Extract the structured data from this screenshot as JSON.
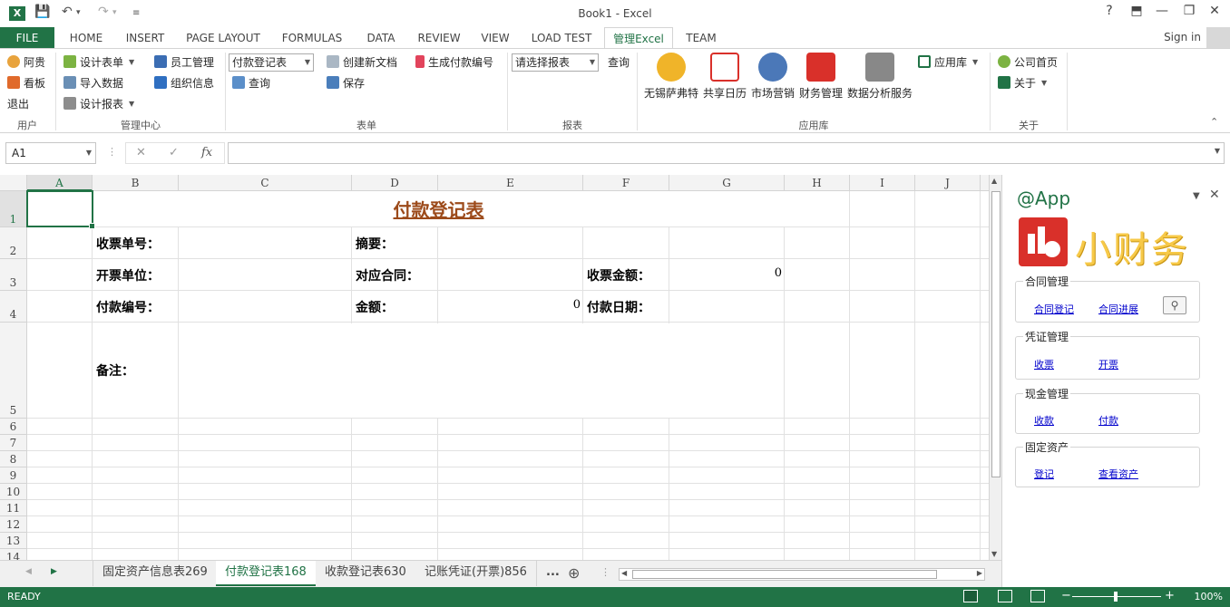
{
  "titlebar": {
    "title": "Book1 - Excel",
    "help": "?",
    "minimize": "—",
    "restore": "❐",
    "close": "✕"
  },
  "tabs": {
    "file": "FILE",
    "items": [
      "HOME",
      "INSERT",
      "PAGE LAYOUT",
      "FORMULAS",
      "DATA",
      "REVIEW",
      "VIEW",
      "LOAD TEST",
      "管理Excel",
      "TEAM"
    ],
    "active": "管理Excel",
    "signin": "Sign in"
  },
  "ribbon": {
    "user": {
      "name": "阿贵",
      "board": "看板",
      "logout": "退出",
      "label": "用户"
    },
    "mgmt": {
      "design_form": "设计表单",
      "import": "导入数据",
      "design_report": "设计报表",
      "staff": "员工管理",
      "org": "组织信息",
      "label": "管理中心"
    },
    "form": {
      "combo": "付款登记表",
      "query": "查询",
      "create": "创建新文档",
      "save": "保存",
      "gen": "生成付款编号",
      "label": "表单"
    },
    "report": {
      "combo": "请选择报表",
      "query": "查询",
      "label": "报表"
    },
    "apps": {
      "items": [
        "无锡萨弗特",
        "共享日历",
        "市场营销",
        "财务管理",
        "数据分析服务"
      ],
      "store": "应用库",
      "label": "应用库"
    },
    "about": {
      "home": "公司首页",
      "about": "关于",
      "label": "关于"
    }
  },
  "formula": {
    "namebox": "A1",
    "cancel": "✕",
    "enter": "✓",
    "fx": "fx",
    "value": ""
  },
  "grid": {
    "columns": [
      "A",
      "B",
      "C",
      "D",
      "E",
      "F",
      "G",
      "H",
      "I",
      "J"
    ],
    "rows": [
      "1",
      "2",
      "3",
      "4",
      "5",
      "6",
      "7",
      "8",
      "9",
      "10",
      "11",
      "12",
      "13",
      "14"
    ],
    "title": "付款登记表",
    "labels": {
      "receipt_no": "收票单号：",
      "summary": "摘要：",
      "issuer": "开票单位：",
      "contract": "对应合同：",
      "receipt_amount": "收票金额：",
      "payment_no": "付款编号：",
      "amount": "金额：",
      "pay_date": "付款日期：",
      "remarks": "备注："
    },
    "values": {
      "receipt_amount": "0",
      "amount": "0"
    }
  },
  "sheets": {
    "items": [
      "固定资产信息表269",
      "付款登记表168",
      "收款登记表630",
      "记账凭证(开票)856"
    ],
    "active": "付款登记表168",
    "more": "...",
    "add": "⊕"
  },
  "pane": {
    "title": "@App",
    "app_name": "小财务",
    "groups": [
      {
        "label": "合同管理",
        "links": [
          "合同登记",
          "合同进展"
        ]
      },
      {
        "label": "凭证管理",
        "links": [
          "收票",
          "开票"
        ]
      },
      {
        "label": "现金管理",
        "links": [
          "收款",
          "付款"
        ]
      },
      {
        "label": "固定资产",
        "links": [
          "登记",
          "查看资产"
        ]
      }
    ]
  },
  "status": {
    "ready": "READY",
    "zoom": "100%",
    "minus": "−",
    "plus": "+"
  },
  "colors": {
    "excel_green": "#217346",
    "title_brown": "#9c4a1a",
    "app_red": "#d9302a",
    "app_yellow": "#f7c948",
    "link_blue": "#0000cc"
  }
}
